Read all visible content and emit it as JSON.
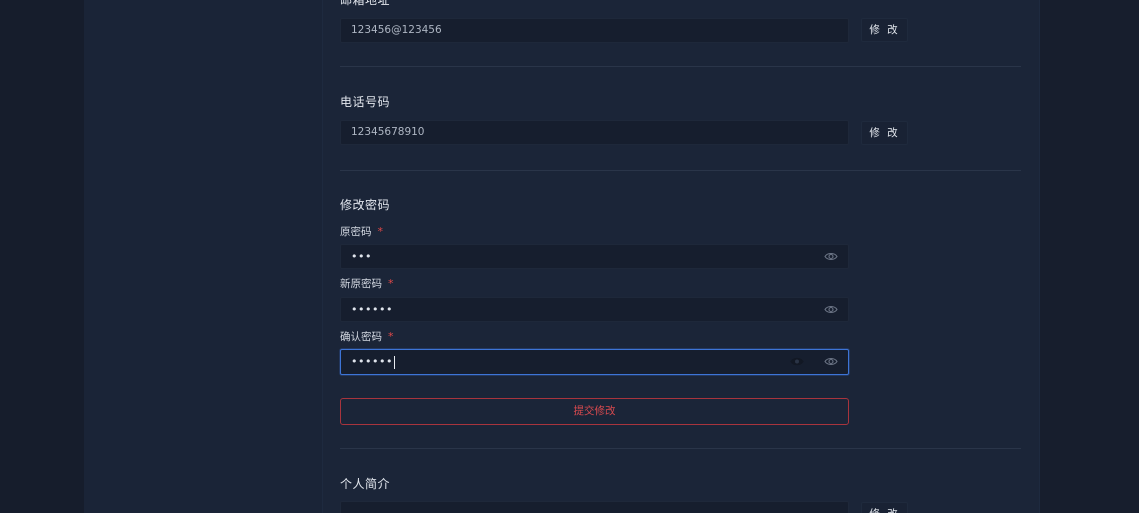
{
  "email": {
    "title": "邮箱地址",
    "value": "123456@123456",
    "edit_label": "修 改"
  },
  "phone": {
    "title": "电话号码",
    "value": "12345678910",
    "edit_label": "修 改"
  },
  "password": {
    "title": "修改密码",
    "old_label": "原密码",
    "old_value": "•••",
    "new_label": "新原密码",
    "new_value": "••••••",
    "confirm_label": "确认密码",
    "confirm_value": "••••••",
    "required_mark": "*",
    "submit_label": "提交修改"
  },
  "bio": {
    "title": "个人简介",
    "edit_label": "修 改"
  },
  "colors": {
    "accent_focus": "#3d74d6",
    "danger": "#d94a4f",
    "required": "#e04848"
  },
  "icons": {
    "visibility": "eye-icon",
    "clear": "eye-filled-icon"
  }
}
